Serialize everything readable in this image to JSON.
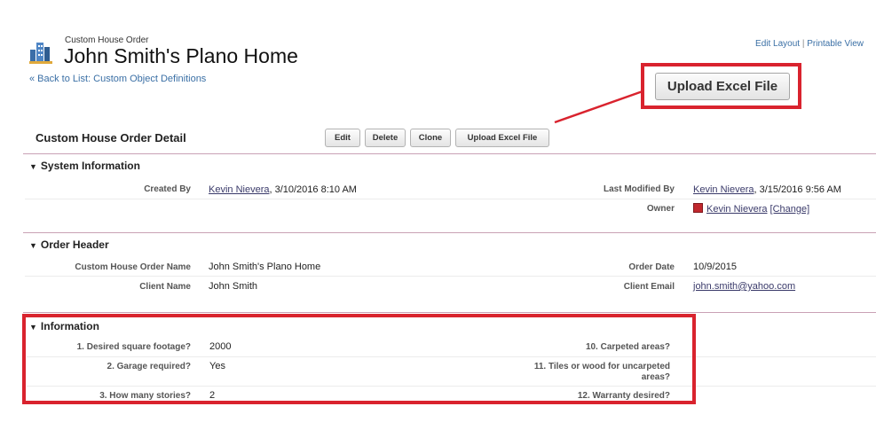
{
  "header": {
    "object_type": "Custom House Order",
    "title": "John Smith's Plano Home",
    "back_link": "« Back to List: Custom Object Definitions",
    "edit_layout": "Edit Layout",
    "link_separator": "|",
    "printable_view": "Printable View"
  },
  "callout": {
    "upload_button": "Upload Excel File"
  },
  "detail": {
    "title": "Custom House Order Detail",
    "buttons": {
      "edit": "Edit",
      "delete": "Delete",
      "clone": "Clone",
      "upload": "Upload Excel File"
    }
  },
  "system_info": {
    "heading": "System Information",
    "created_by_label": "Created By",
    "created_by_user": "Kevin Nievera",
    "created_by_date": ", 3/10/2016 8:10 AM",
    "last_modified_label": "Last Modified By",
    "last_modified_user": "Kevin Nievera",
    "last_modified_date": ", 3/15/2016 9:56 AM",
    "owner_label": "Owner",
    "owner_name": "Kevin Nievera",
    "owner_change": "[Change]"
  },
  "order_header": {
    "heading": "Order Header",
    "name_label": "Custom House Order Name",
    "name_value": "John Smith's Plano Home",
    "order_date_label": "Order Date",
    "order_date_value": "10/9/2015",
    "client_name_label": "Client Name",
    "client_name_value": "John Smith",
    "client_email_label": "Client Email",
    "client_email_value": "john.smith@yahoo.com"
  },
  "information": {
    "heading": "Information",
    "q1_label": "1. Desired square footage?",
    "q1_value": "2000",
    "q2_label": "2. Garage required?",
    "q2_value": "Yes",
    "q3_label": "3. How many stories?",
    "q3_value": "2",
    "q10_label": "10. Carpeted areas?",
    "q11_label_line1": "11. Tiles or wood for uncarpeted",
    "q11_label_line2": "areas?",
    "q12_label": "12. Warranty desired?"
  },
  "colors": {
    "highlight_red": "#d9232e",
    "link_blue": "#3a6fa5",
    "section_rule": "#c9a1b5"
  },
  "icons": {
    "logo": "building-icon",
    "owner": "user-icon",
    "collapse": "triangle-down-icon"
  }
}
